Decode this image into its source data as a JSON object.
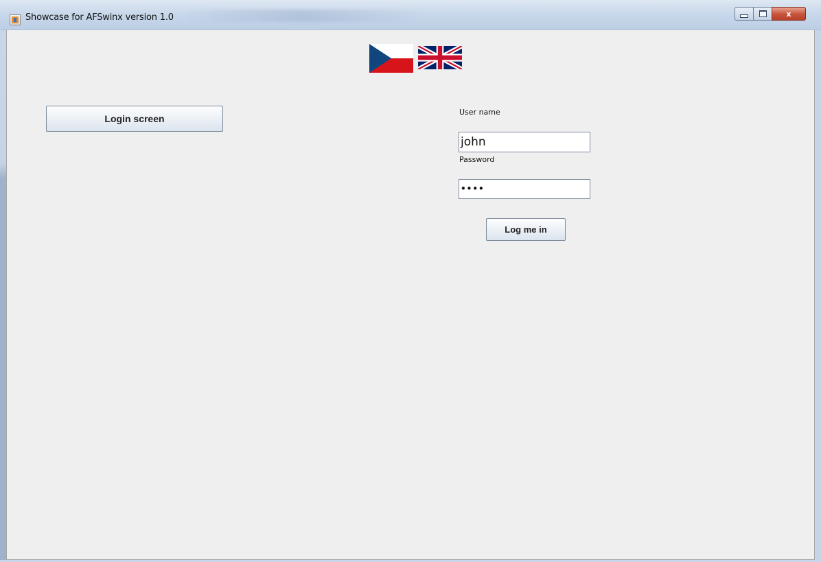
{
  "window": {
    "title": "Showcase for AFSwinx version 1.0",
    "controls": {
      "minimize_icon": "minimize-icon",
      "maximize_icon": "maximize-icon",
      "close_label": "x"
    }
  },
  "languages": [
    {
      "name": "czech-flag",
      "colors": [
        "#ffffff",
        "#d7141a",
        "#11457e"
      ]
    },
    {
      "name": "uk-flag",
      "colors": [
        "#012169",
        "#ffffff",
        "#c8102e"
      ]
    }
  ],
  "menu": {
    "login_screen_label": "Login screen"
  },
  "login_form": {
    "username_label": "User name",
    "username_value": "john",
    "password_label": "Password",
    "password_masked": "••••",
    "submit_label": "Log me in"
  }
}
